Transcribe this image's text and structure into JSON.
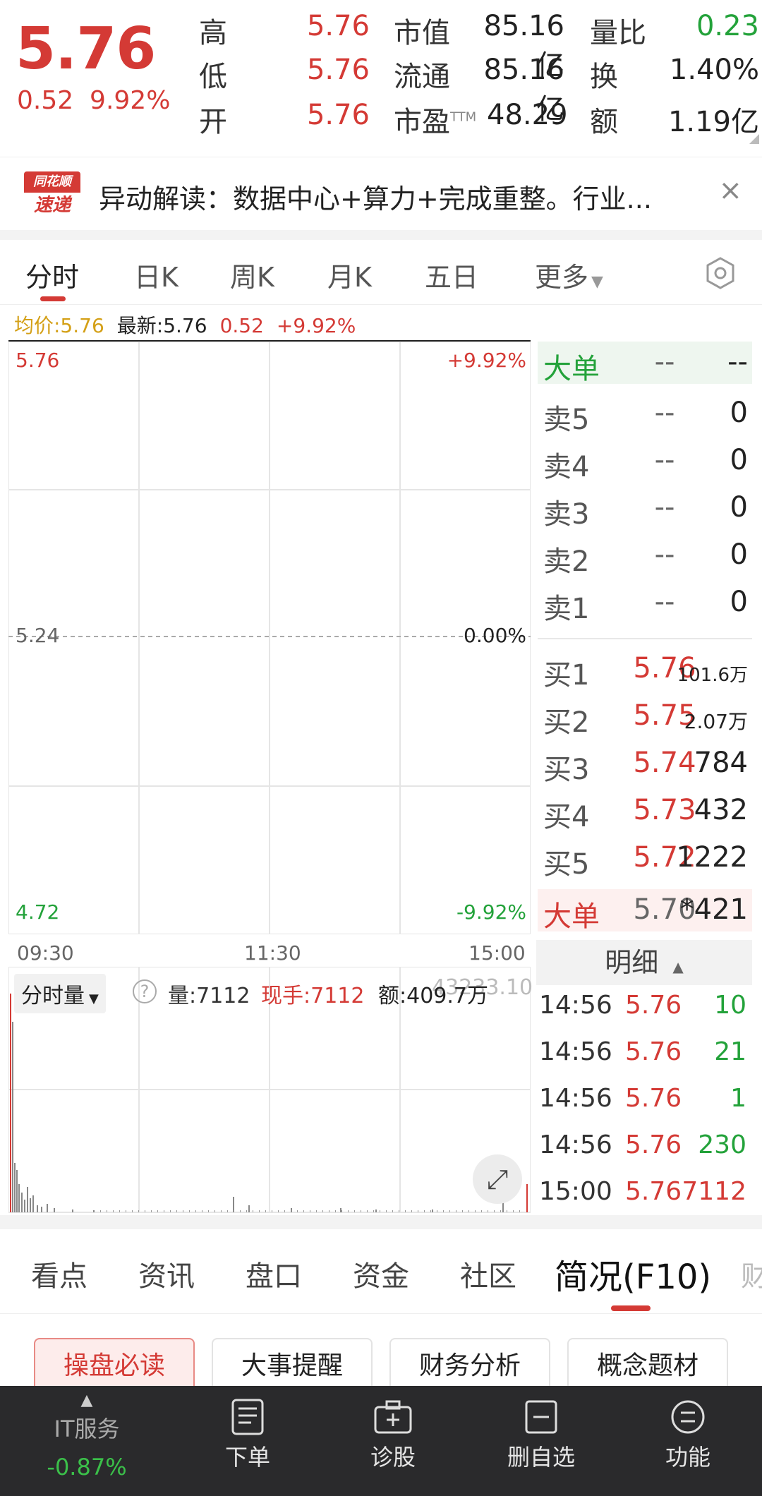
{
  "quote": {
    "price": "5.76",
    "change": "0.52",
    "change_pct": "9.92%",
    "high_label": "高",
    "high": "5.76",
    "low_label": "低",
    "low": "5.76",
    "open_label": "开",
    "open": "5.76",
    "mktcap_label": "市值",
    "mktcap": "85.16亿",
    "float_label": "流通",
    "float": "85.16亿",
    "pe_label": "市盈",
    "pe_sup": "TTM",
    "pe": "48.29",
    "volratio_label": "量比",
    "volratio": "0.23",
    "turnover_label": "换",
    "turnover": "1.40%",
    "amount_label": "额",
    "amount": "1.19亿"
  },
  "news": {
    "logo_top": "同花顺",
    "logo_bottom": "速递",
    "text": "异动解读：数据中心+算力+完成重整。行业...",
    "close": "×"
  },
  "tabs": [
    "分时",
    "日K",
    "周K",
    "月K",
    "五日",
    "更多"
  ],
  "infoline": {
    "avg_label": "均价:5.76",
    "latest_label": "最新:5.76",
    "change": "0.52",
    "change_pct": "+9.92%"
  },
  "chart": {
    "top_price": "5.76",
    "top_pct": "+9.92%",
    "mid_price": "5.24",
    "mid_pct": "0.00%",
    "bot_price": "4.72",
    "bot_pct": "-9.92%",
    "times": [
      "09:30",
      "11:30",
      "15:00"
    ]
  },
  "book": {
    "big_sell": {
      "label": "大单",
      "p": "--",
      "v": "--"
    },
    "sells": [
      {
        "label": "卖5",
        "p": "--",
        "v": "0"
      },
      {
        "label": "卖4",
        "p": "--",
        "v": "0"
      },
      {
        "label": "卖3",
        "p": "--",
        "v": "0"
      },
      {
        "label": "卖2",
        "p": "--",
        "v": "0"
      },
      {
        "label": "卖1",
        "p": "--",
        "v": "0"
      }
    ],
    "buys": [
      {
        "label": "买1",
        "p": "5.76",
        "v": "101.6万"
      },
      {
        "label": "买2",
        "p": "5.75",
        "v": "2.07万"
      },
      {
        "label": "买3",
        "p": "5.74",
        "v": "784"
      },
      {
        "label": "买4",
        "p": "5.73",
        "v": "432"
      },
      {
        "label": "买5",
        "p": "5.72",
        "v": "1222"
      }
    ],
    "big_buy": {
      "label": "大单",
      "p": "5.70",
      "v": "*421"
    }
  },
  "volume": {
    "dropdown": "分时量",
    "vol": "量:7112",
    "cur": "现手:7112",
    "amt": "额:409.7万",
    "max": "43233.10"
  },
  "detail": {
    "title": "明细",
    "rows": [
      {
        "t": "14:56",
        "p": "5.76",
        "v": "10",
        "dir": "green"
      },
      {
        "t": "14:56",
        "p": "5.76",
        "v": "21",
        "dir": "green"
      },
      {
        "t": "14:56",
        "p": "5.76",
        "v": "1",
        "dir": "green"
      },
      {
        "t": "14:56",
        "p": "5.76",
        "v": "230",
        "dir": "green"
      },
      {
        "t": "15:00",
        "p": "5.76",
        "v": "7112",
        "dir": "red"
      }
    ]
  },
  "sections": [
    "看点",
    "资讯",
    "盘口",
    "资金",
    "社区",
    "简况(F10)",
    "财"
  ],
  "chips": [
    "操盘必读",
    "大事提醒",
    "财务分析",
    "概念题材"
  ],
  "nav": {
    "it_label": "IT服务",
    "it_change": "-0.87%",
    "items": [
      "下单",
      "诊股",
      "删自选",
      "功能"
    ]
  },
  "colors": {
    "up": "#d43a35",
    "down": "#23a23a",
    "avg": "#d4a017",
    "nav_bg": "#2a2a2c"
  }
}
